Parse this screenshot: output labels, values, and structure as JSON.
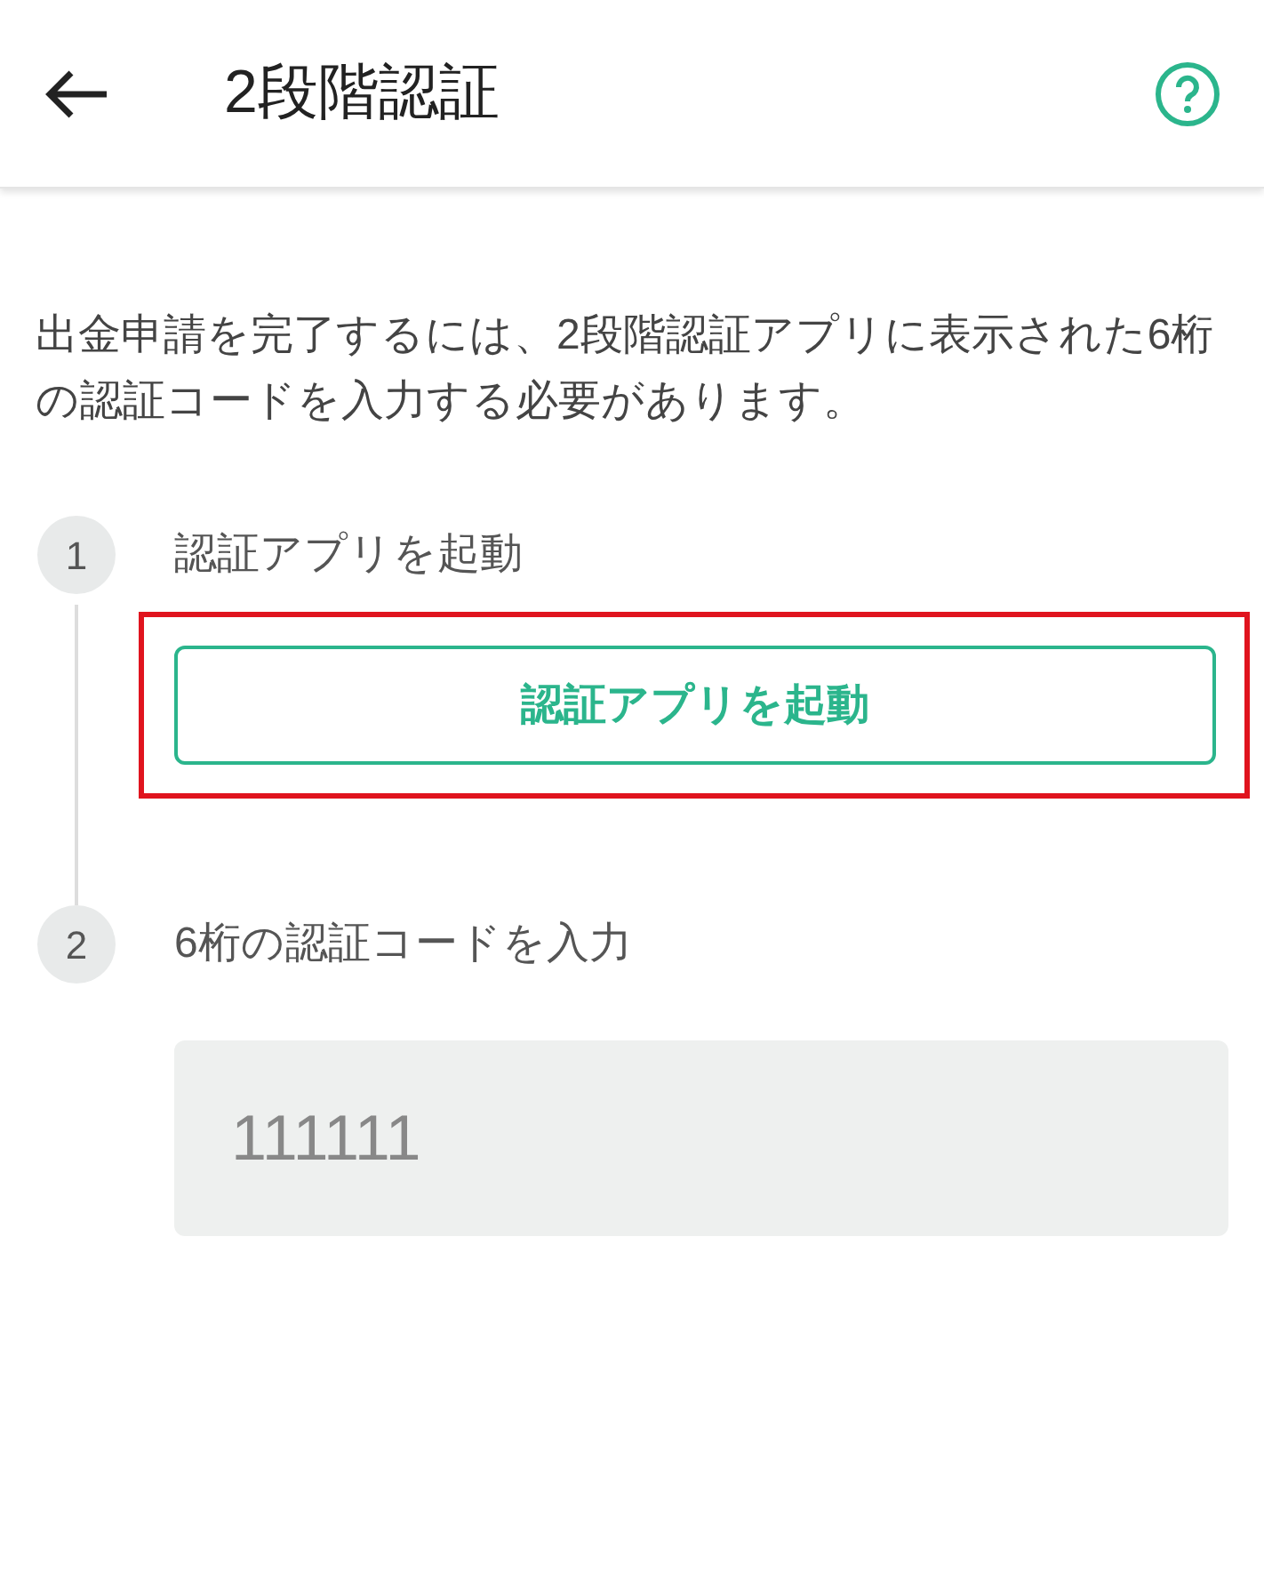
{
  "header": {
    "title": "2段階認証"
  },
  "description": "出金申請を完了するには、2段階認証アプリに表示された6桁の認証コードを入力する必要があります。",
  "steps": [
    {
      "number": "1",
      "label": "認証アプリを起動",
      "kind": "button",
      "button": {
        "label": "認証アプリを起動",
        "highlighted": true
      }
    },
    {
      "number": "2",
      "label": "6桁の認証コードを入力",
      "kind": "input",
      "input": {
        "placeholder": "111111"
      }
    }
  ]
}
